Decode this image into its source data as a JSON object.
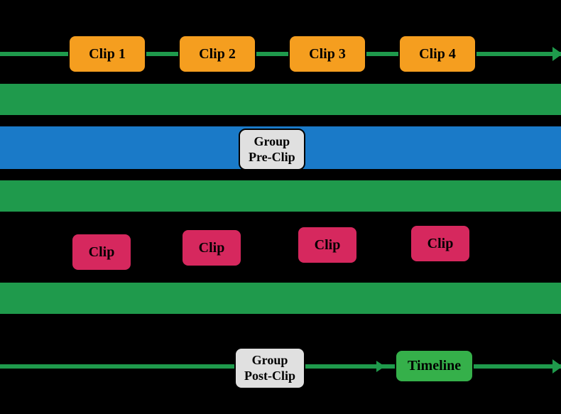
{
  "clips_top": [
    {
      "label": "Clip 1"
    },
    {
      "label": "Clip 2"
    },
    {
      "label": "Clip 3"
    },
    {
      "label": "Clip 4"
    }
  ],
  "group_pre_clip": "Group\nPre-Clip",
  "clips_mid": [
    {
      "label": "Clip"
    },
    {
      "label": "Clip"
    },
    {
      "label": "Clip"
    },
    {
      "label": "Clip"
    }
  ],
  "group_post_clip": "Group\nPost-Clip",
  "timeline": "Timeline",
  "colors": {
    "green": "#1f9a4c",
    "blue": "#1a7ac8",
    "orange": "#f59e1f",
    "pink": "#d6285e",
    "gray": "#e0e0e0",
    "green_box": "#35b04a"
  }
}
